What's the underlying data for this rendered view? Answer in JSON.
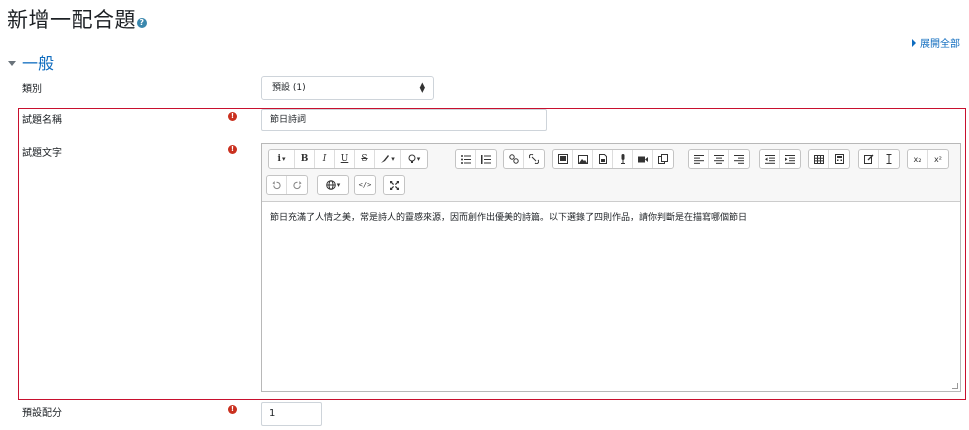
{
  "page": {
    "title": "新增一配合題",
    "help_icon": "help-icon",
    "expand_all": "展開全部",
    "section": "一般"
  },
  "form": {
    "category": {
      "label": "類別",
      "value": "預設 (1)"
    },
    "question_name": {
      "label": "試題名稱",
      "value": "節日詩詞",
      "required": true
    },
    "question_text": {
      "label": "試題文字",
      "required": true,
      "content": "節日充滿了人情之美，常是詩人的靈感來源，因而創作出優美的詩篇。以下選錄了四則作品，請你判斷是在描寫哪個節日"
    },
    "default_mark": {
      "label": "預設配分",
      "value": "1",
      "required": true
    }
  },
  "toolbar": {
    "row1": [
      [
        "info-icon",
        "bold-icon",
        "italic-icon",
        "underline-icon",
        "strikethrough-icon",
        "text-color-icon",
        "highlight-icon"
      ],
      [
        "unordered-list-icon",
        "ordered-list-icon"
      ],
      [
        "link-icon",
        "unlink-icon"
      ],
      [
        "media-manager-icon",
        "image-icon",
        "file-icon",
        "record-audio-icon",
        "record-video-icon",
        "manage-files-icon"
      ],
      [
        "align-left-icon",
        "align-center-icon",
        "align-right-icon"
      ],
      [
        "outdent-icon",
        "indent-icon"
      ],
      [
        "table-icon",
        "calculator-icon"
      ],
      [
        "clear-format-icon",
        "character-icon"
      ],
      [
        "subscript-icon",
        "superscript-icon"
      ]
    ],
    "row2": [
      [
        "undo-icon",
        "redo-icon"
      ],
      [
        "language-icon"
      ],
      [
        "html-icon"
      ],
      [
        "fullscreen-icon"
      ]
    ],
    "labels": {
      "bold": "B",
      "italic": "I",
      "underline": "U",
      "strike": "S",
      "subscript": "x₂",
      "superscript": "x²",
      "html": "</>",
      "info": "i"
    }
  },
  "colors": {
    "accent": "#0f6cbf",
    "required": "#ca3120",
    "highlight_border": "#c8102e"
  }
}
